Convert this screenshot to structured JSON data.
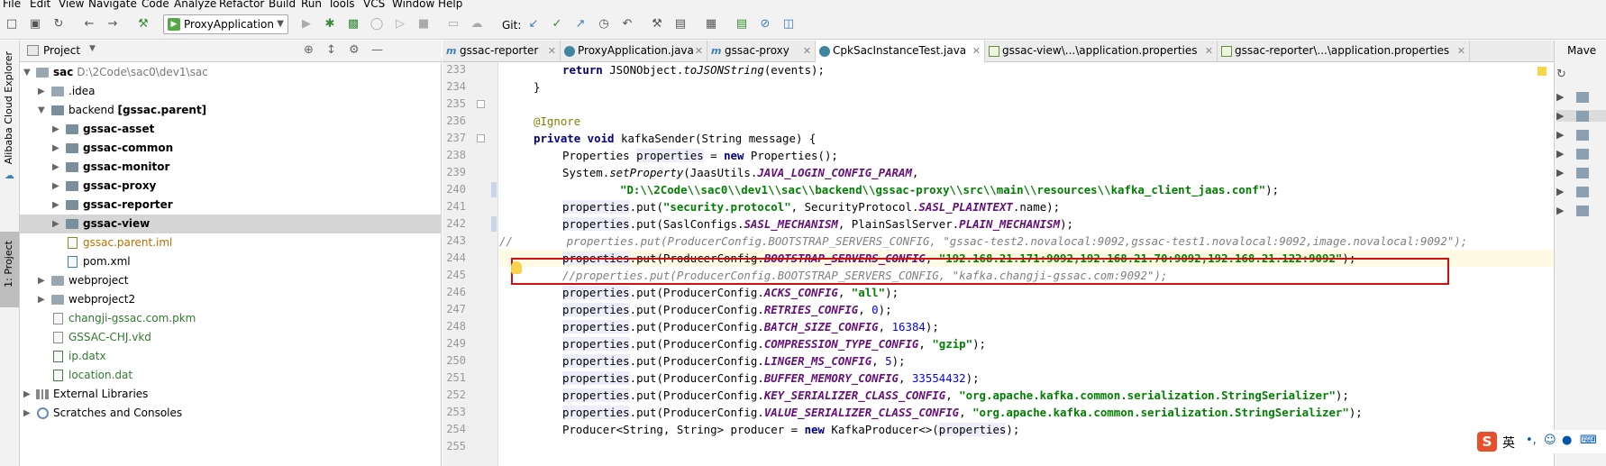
{
  "menu": [
    "File",
    "Edit",
    "View",
    "Navigate",
    "Code",
    "Analyze",
    "Refactor",
    "Build",
    "Run",
    "Tools",
    "VCS",
    "Window",
    "Help"
  ],
  "toolbar": {
    "run_config": "ProxyApplication",
    "git_label": "Git:"
  },
  "side_tabs": {
    "cloud_explorer": "Alibaba Cloud Explorer",
    "project": "1: Project"
  },
  "project_panel": {
    "title": "Project"
  },
  "tree": [
    {
      "label": "sac",
      "path": "D:\\2Code\\sac0\\dev1\\sac"
    },
    {
      "label": ".idea"
    },
    {
      "label": "backend",
      "module": "[gssac.parent]"
    },
    {
      "label": "gssac-asset"
    },
    {
      "label": "gssac-common"
    },
    {
      "label": "gssac-monitor"
    },
    {
      "label": "gssac-proxy"
    },
    {
      "label": "gssac-reporter"
    },
    {
      "label": "gssac-view"
    },
    {
      "label": "gssac.parent.iml"
    },
    {
      "label": "pom.xml"
    },
    {
      "label": "webproject"
    },
    {
      "label": "webproject2"
    },
    {
      "label": "changji-gssac.com.pkm"
    },
    {
      "label": "GSSAC-CHJ.vkd"
    },
    {
      "label": "ip.datx"
    },
    {
      "label": "location.dat"
    },
    {
      "label": "External Libraries"
    },
    {
      "label": "Scratches and Consoles"
    }
  ],
  "editor_tabs": [
    {
      "label": "gssac-reporter"
    },
    {
      "label": "ProxyApplication.java"
    },
    {
      "label": "gssac-proxy"
    },
    {
      "label": "CpkSacInstanceTest.java"
    },
    {
      "label": "gssac-view\\...\\application.properties"
    },
    {
      "label": "gssac-reporter\\...\\application.properties"
    }
  ],
  "right_panel": {
    "title": "Mave"
  },
  "line_numbers": [
    "233",
    "234",
    "235",
    "236",
    "237",
    "238",
    "239",
    "240",
    "241",
    "242",
    "243",
    "244",
    "245",
    "246",
    "247",
    "248",
    "249",
    "250",
    "251",
    "252",
    "253",
    "254",
    "255"
  ],
  "code": {
    "l233_a": "return ",
    "l233_b": "JSONObject.",
    "l233_c": "toJSONString",
    "l233_d": "(events);",
    "l234": "}",
    "l236": "@Ignore",
    "l237_kw": "private void ",
    "l237_rest": "kafkaSender(String message) {",
    "l238_a": "Properties ",
    "l238_b": "properties",
    "l238_c": " = ",
    "l238_d": "new ",
    "l238_e": "Properties();",
    "l239_a": "System.",
    "l239_b": "setProperty",
    "l239_c": "(JaasUtils.",
    "l239_d": "JAVA_LOGIN_CONFIG_PARAM",
    "l239_e": ",",
    "l240_str": "\"D:\\\\2Code\\\\sac0\\\\dev1\\\\sac\\\\backend\\\\gssac-proxy\\\\src\\\\main\\\\resources\\\\kafka_client_jaas.conf\"",
    "l240_end": ");",
    "l241_a": "properties",
    "l241_b": ".put(",
    "l241_c": "\"security.protocol\"",
    "l241_d": ", SecurityProtocol.",
    "l241_e": "SASL_PLAINTEXT",
    "l241_f": ".name);",
    "l242_a": "properties",
    "l242_b": ".put(SaslConfigs.",
    "l242_c": "SASL_MECHANISM",
    "l242_d": ", PlainSaslServer.",
    "l242_e": "PLAIN_MECHANISM",
    "l242_f": ");",
    "l243": "//        properties.put(ProducerConfig.BOOTSTRAP_SERVERS_CONFIG, \"gssac-test2.novalocal:9092,gssac-test1.novalocal:9092,image.novalocal:9092\");",
    "l244_a": "properties",
    "l244_b": ".put(ProducerConfig.",
    "l244_c": "BOOTSTRAP_SERVERS_CONFIG",
    "l244_d": ", ",
    "l244_e": "\"192.168.21.171:9092,192.168.21.70:9092,192.168.21.122:9092\"",
    "l244_f": ");",
    "l245": "//properties.put(ProducerConfig.BOOTSTRAP_SERVERS_CONFIG, \"kafka.changji-gssac.com:9092\");",
    "l246_c": "ACKS_CONFIG",
    "l246_v": "\"all\"",
    "l247_c": "RETRIES_CONFIG",
    "l247_v": "0",
    "l248_c": "BATCH_SIZE_CONFIG",
    "l248_v": "16384",
    "l249_c": "COMPRESSION_TYPE_CONFIG",
    "l249_v": "\"gzip\"",
    "l250_c": "LINGER_MS_CONFIG",
    "l250_v": "5",
    "l251_c": "BUFFER_MEMORY_CONFIG",
    "l251_v": "33554432",
    "l252_c": "KEY_SERIALIZER_CLASS_CONFIG",
    "l252_v": "\"org.apache.kafka.common.serialization.StringSerializer\"",
    "l253_c": "VALUE_SERIALIZER_CLASS_CONFIG",
    "l253_v": "\"org.apache.kafka.common.serialization.StringSerializer\"",
    "put_prefix_a": "properties",
    "put_prefix_b": ".put(ProducerConfig.",
    "comma": ", ",
    "close": ");",
    "l254_a": "Producer<String, String> producer = ",
    "l254_b": "new ",
    "l254_c": "KafkaProducer<>(",
    "l254_d": "properties",
    "l254_e": ");"
  },
  "ime": {
    "logo": "S",
    "text": "英"
  },
  "colors": {
    "highlight_box": "#d01010",
    "keyword": "#000080",
    "string": "#008000",
    "constant": "#660e7a"
  }
}
